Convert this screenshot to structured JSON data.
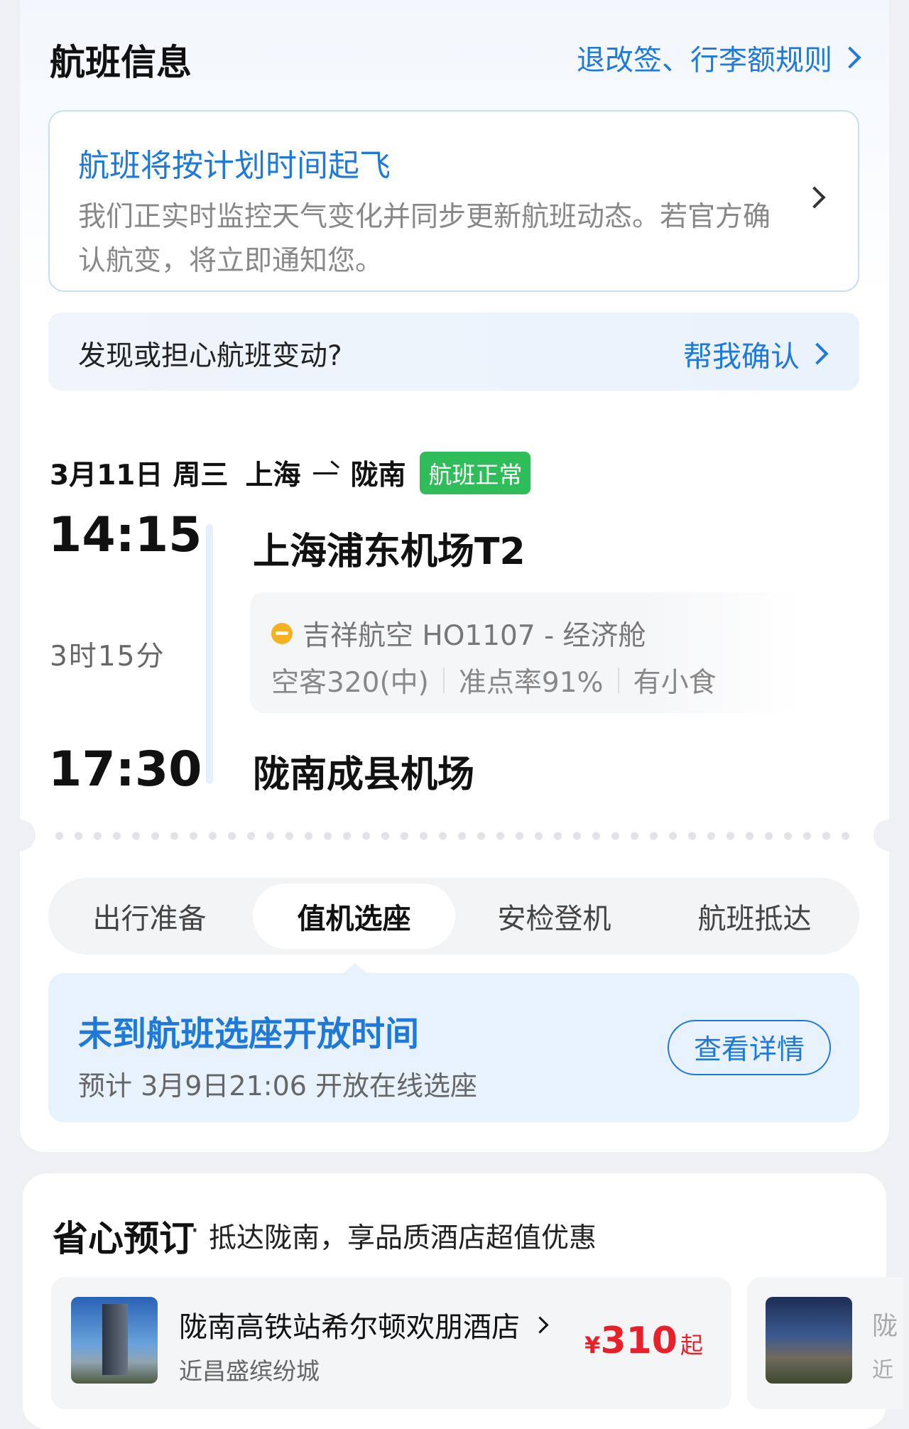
{
  "header": {
    "title": "航班信息",
    "rules_link": "退改签、行李额规则"
  },
  "status": {
    "title": "航班将按计划时间起飞",
    "description": "我们正实时监控天气变化并同步更新航班动态。若官方确认航变，将立即通知您。"
  },
  "concern": {
    "text": "发现或担心航班变动?",
    "link": "帮我确认"
  },
  "route": {
    "date": "3月11日",
    "weekday": "周三",
    "from_city": "上海",
    "to_city": "陇南",
    "badge": "航班正常",
    "badge_color": "#2fbd5a"
  },
  "flight": {
    "depart_time": "14:15",
    "arrive_time": "17:30",
    "duration": "3时15分",
    "depart_airport": "上海浦东机场T2",
    "arrive_airport": "陇南成县机场",
    "airline_info": "吉祥航空 HO1107 - 经济舱",
    "aircraft": "空客320(中)",
    "on_time_rate": "准点率91%",
    "meal": "有小食"
  },
  "tabs": [
    {
      "label": "出行准备",
      "active": false
    },
    {
      "label": "值机选座",
      "active": true
    },
    {
      "label": "安检登机",
      "active": false
    },
    {
      "label": "航班抵达",
      "active": false
    }
  ],
  "seat": {
    "title": "未到航班选座开放时间",
    "subtitle": "预计 3月9日21:06 开放在线选座",
    "button": "查看详情"
  },
  "recommend": {
    "title": "省心预订",
    "subtitle": "抵达陇南，享品质酒店超值优惠",
    "hotels": [
      {
        "name": "陇南高铁站希尔顿欢朋酒店",
        "location": "近昌盛缤纷城",
        "currency": "¥",
        "price": "310",
        "suffix": "起"
      },
      {
        "name_peek": "陇",
        "location_peek": "近"
      }
    ]
  },
  "colors": {
    "accent": "#1f79d8",
    "price": "#e8202a",
    "page_bg": "#eef0f4"
  }
}
